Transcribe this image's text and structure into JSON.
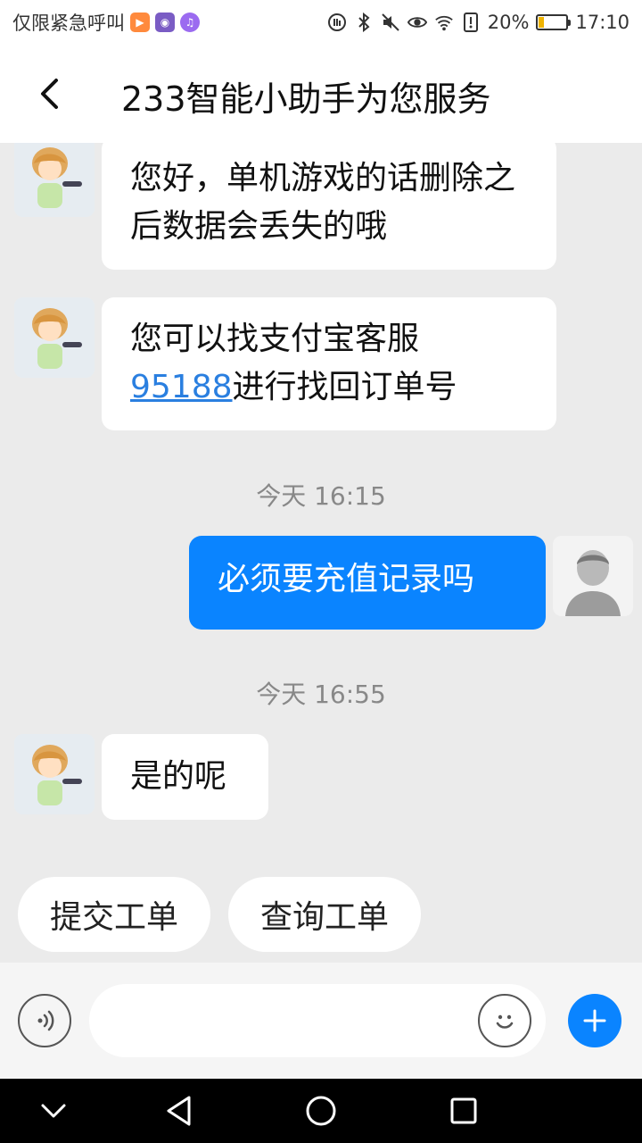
{
  "status_bar": {
    "carrier": "仅限紧急呼叫",
    "battery": "20%",
    "time": "17:10",
    "battery_level": 0.2
  },
  "header": {
    "title": "233智能小助手为您服务"
  },
  "messages": [
    {
      "from": "bot",
      "text": "您好，单机游戏的话删除之后数据会丢失的哦"
    },
    {
      "from": "bot",
      "text_line1": "您可以找支付宝客服",
      "link": "95188",
      "text_line2_rest": "进行找回订单号"
    },
    {
      "type": "time",
      "text": "今天 16:15"
    },
    {
      "from": "user",
      "text": "必须要充值记录吗"
    },
    {
      "type": "time",
      "text": "今天 16:55"
    },
    {
      "from": "bot",
      "text": "是的呢"
    }
  ],
  "quick_actions": [
    "提交工单",
    "查询工单"
  ],
  "input": {
    "value": "",
    "placeholder": ""
  },
  "colors": {
    "accent": "#0a84ff",
    "link": "#2a7fe0",
    "background": "#ebebeb"
  }
}
